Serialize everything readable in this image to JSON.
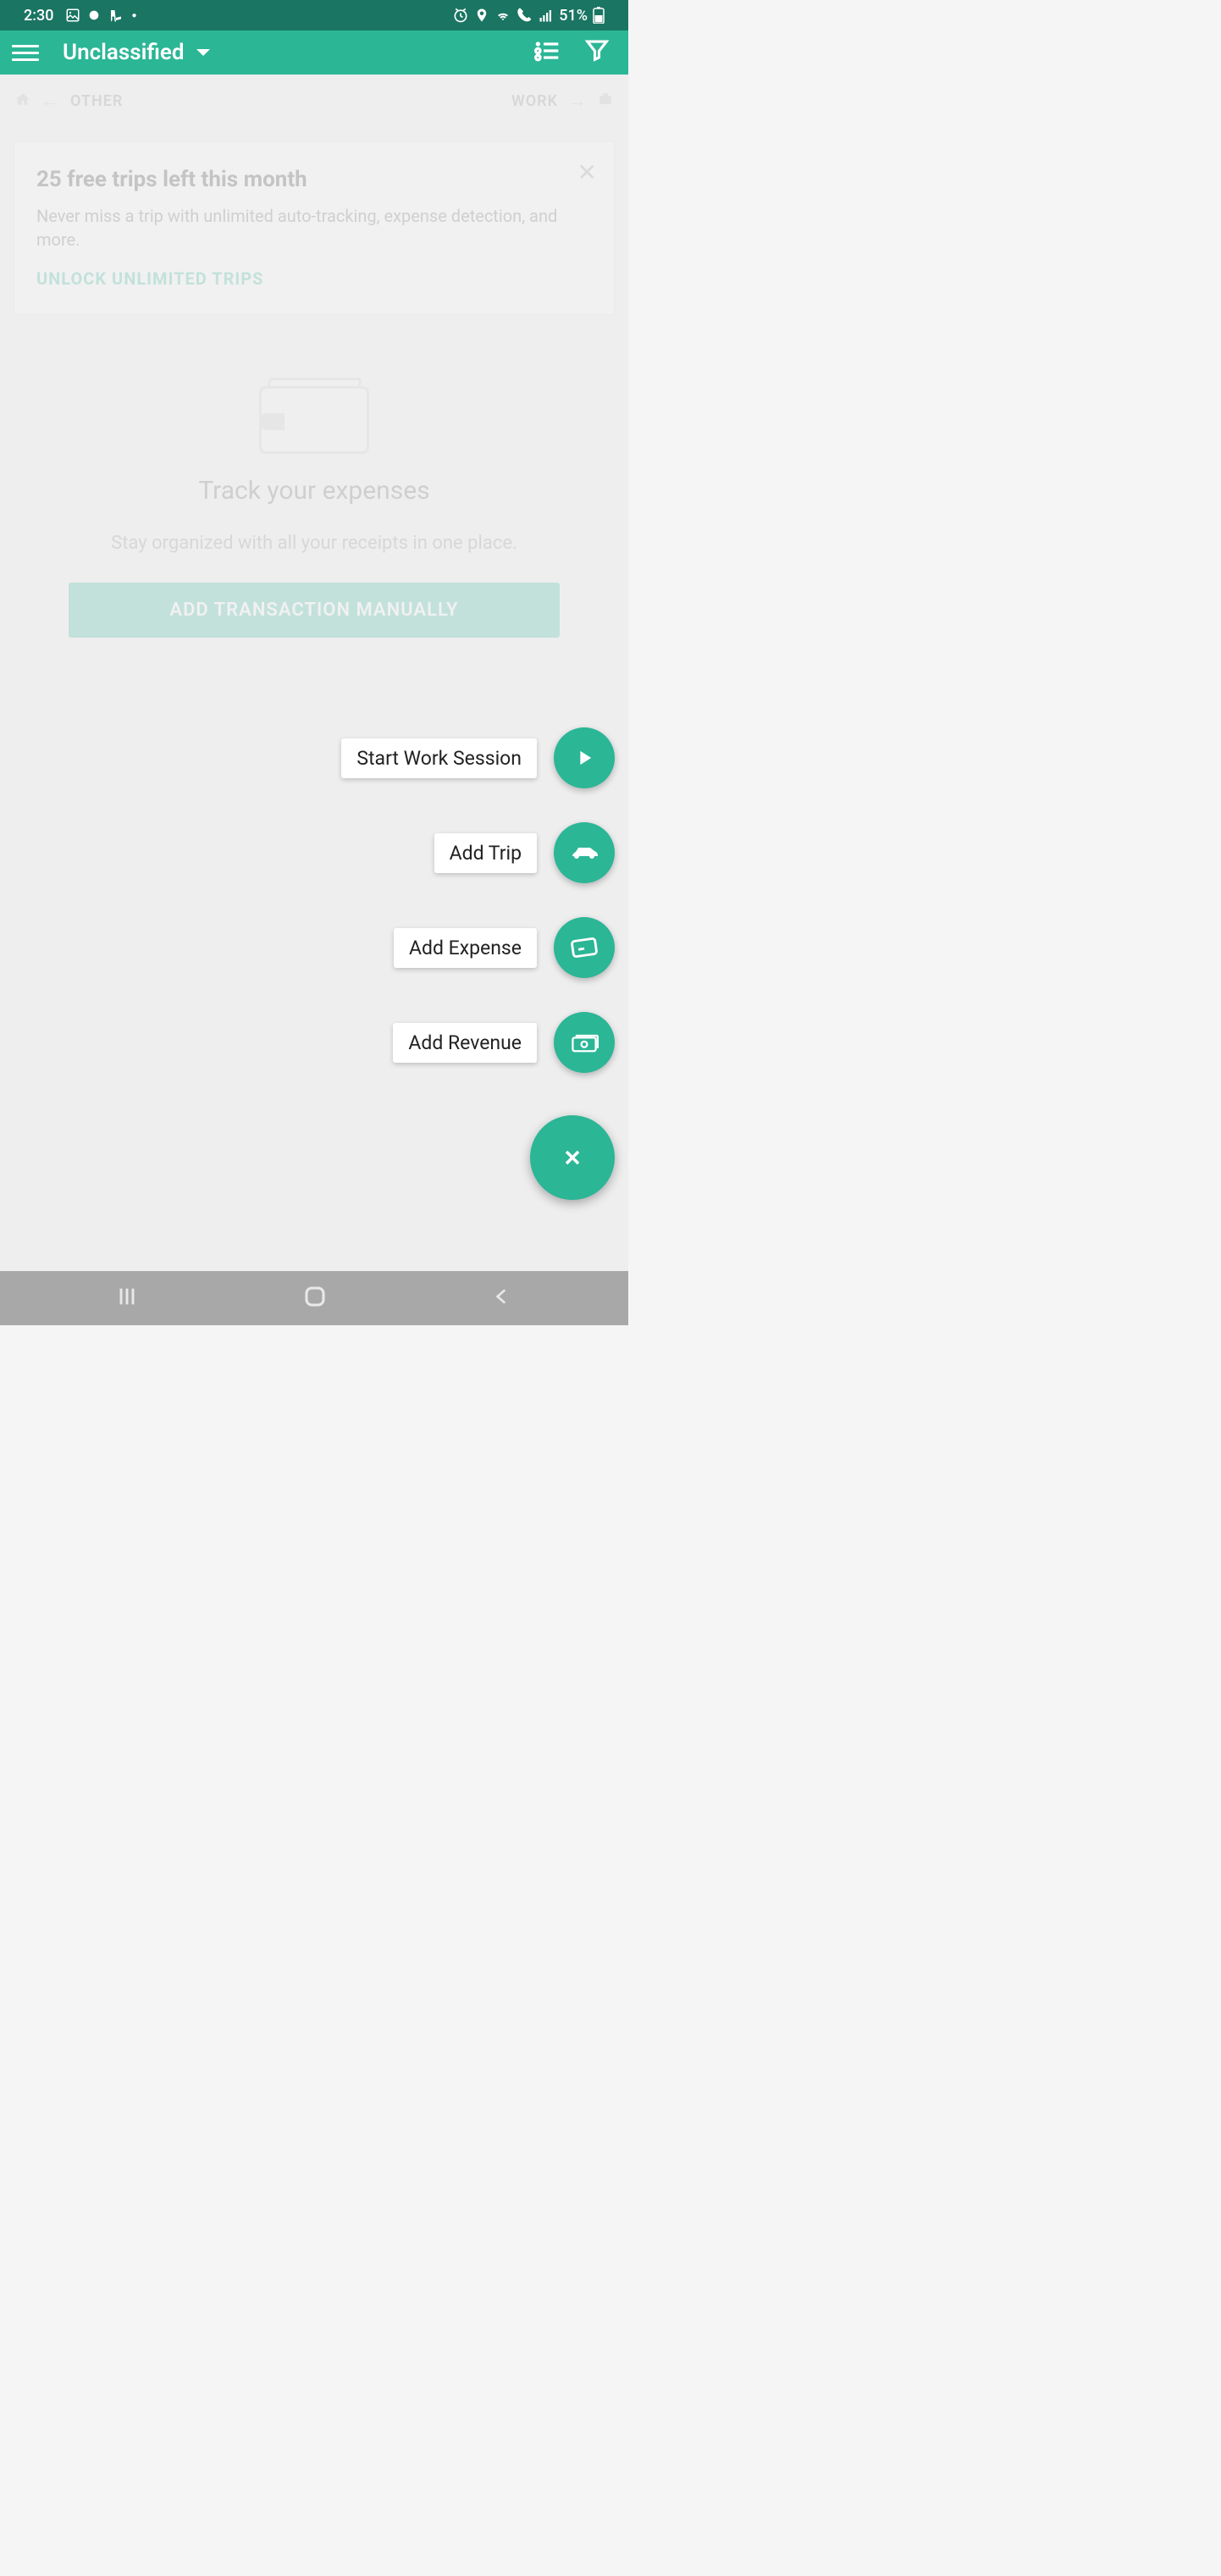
{
  "status": {
    "time": "2:30",
    "battery": "51%"
  },
  "appbar": {
    "title": "Unclassified"
  },
  "swipe": {
    "left_label": "OTHER",
    "right_label": "WORK"
  },
  "promo": {
    "title": "25 free trips left this month",
    "text": "Never miss a trip with unlimited auto-tracking, expense detection, and more.",
    "cta": "UNLOCK UNLIMITED TRIPS"
  },
  "empty": {
    "title": "Track your expenses",
    "text": "Stay organized with all your receipts in one place.",
    "button": "ADD TRANSACTION MANUALLY"
  },
  "fab": {
    "items": [
      {
        "label": "Start Work Session"
      },
      {
        "label": "Add Trip"
      },
      {
        "label": "Add Expense"
      },
      {
        "label": "Add Revenue"
      }
    ]
  }
}
